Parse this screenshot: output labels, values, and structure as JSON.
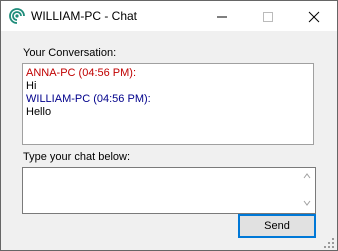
{
  "window": {
    "title": "WILLIAM-PC - Chat",
    "app_icon": "chat-signal-icon",
    "controls": [
      "minimize-icon",
      "maximize-icon",
      "close-icon"
    ]
  },
  "conversation": {
    "label": "Your Conversation:",
    "messages": [
      {
        "header": "ANNA-PC (04:56 PM):",
        "text": "Hi",
        "color": "#c00000"
      },
      {
        "header": "WILLIAM-PC (04:56 PM):",
        "text": "Hello",
        "color": "#00008b"
      }
    ]
  },
  "input": {
    "label": "Type your chat below:",
    "value": ""
  },
  "send_label": "Send",
  "colors": {
    "focus_border": "#0078d7",
    "window_bg": "#f0f0f0"
  }
}
